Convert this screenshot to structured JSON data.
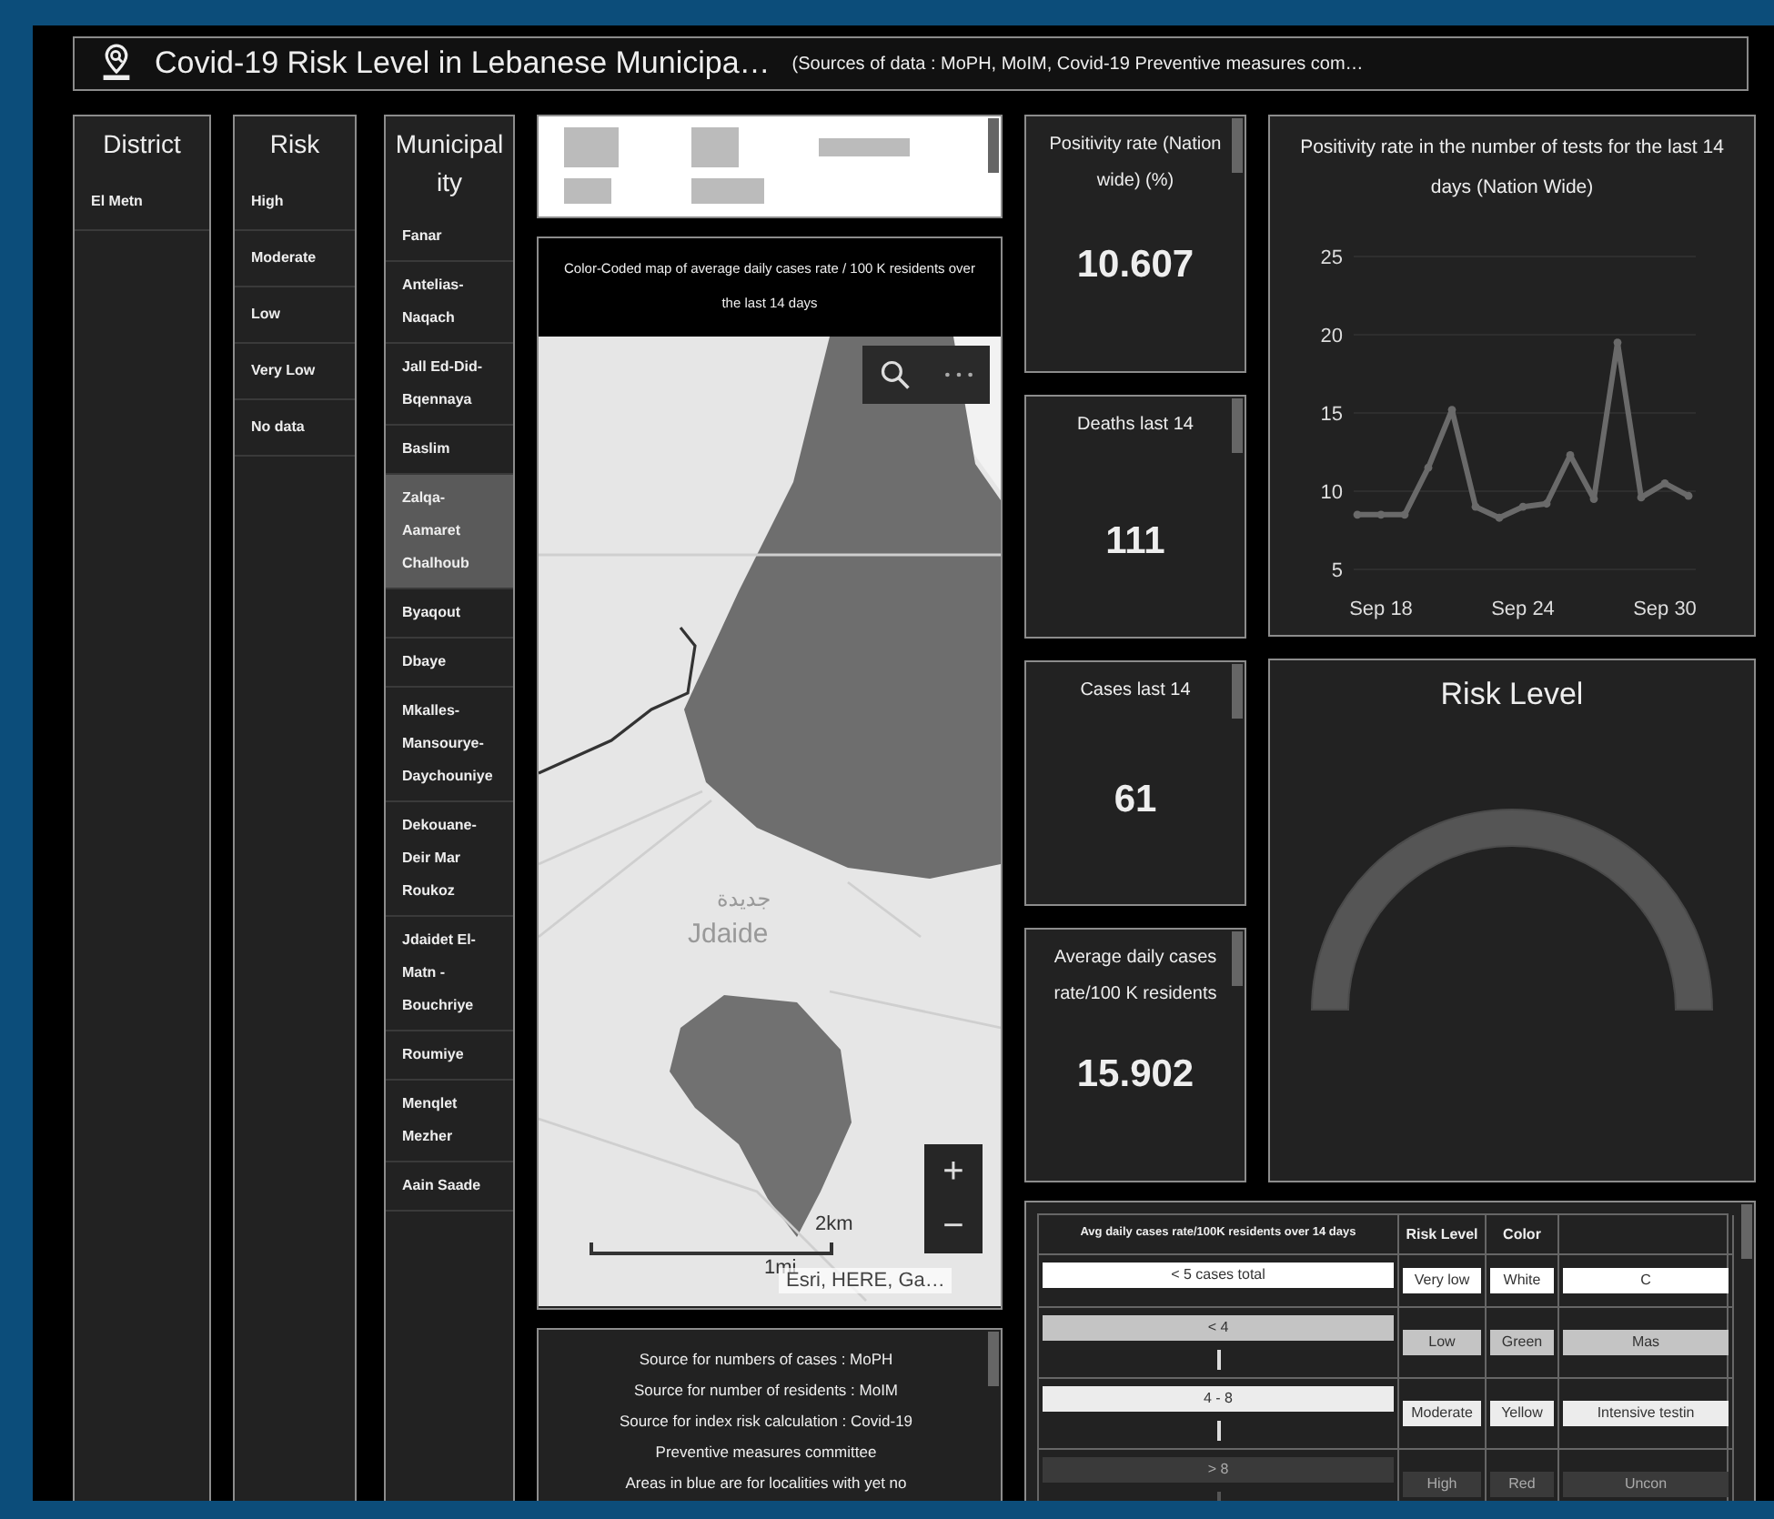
{
  "header": {
    "title": "Covid-19 Risk Level in Lebanese Municipa…",
    "subtitle": "(Sources of data : MoPH, MoIM, Covid-19 Preventive measures com…"
  },
  "district_list": {
    "title": "District",
    "items": [
      {
        "label": "El Metn",
        "selected": false
      }
    ]
  },
  "risk_list": {
    "title": "Risk",
    "items": [
      {
        "label": "High",
        "selected": false
      },
      {
        "label": "Moderate",
        "selected": false
      },
      {
        "label": "Low",
        "selected": false
      },
      {
        "label": "Very Low",
        "selected": false
      },
      {
        "label": "No data",
        "selected": false
      }
    ]
  },
  "municipality_list": {
    "title": "Municipality",
    "items": [
      {
        "label": "Fanar",
        "selected": false
      },
      {
        "label": "Antelias-Naqach",
        "selected": false
      },
      {
        "label": "Jall Ed-Did-Bqennaya",
        "selected": false
      },
      {
        "label": "Baslim",
        "selected": false
      },
      {
        "label": "Zalqa-Aamaret Chalhoub",
        "selected": true
      },
      {
        "label": "Byaqout",
        "selected": false
      },
      {
        "label": "Dbaye",
        "selected": false
      },
      {
        "label": "Mkalles-Mansourye-Daychouniye",
        "selected": false
      },
      {
        "label": "Dekouane-Deir Mar Roukoz",
        "selected": false
      },
      {
        "label": "Jdaidet El-Matn - Bouchriye",
        "selected": false
      },
      {
        "label": "Roumiye",
        "selected": false
      },
      {
        "label": "Menqlet Mezher",
        "selected": false
      },
      {
        "label": "Aain Saade",
        "selected": false
      }
    ]
  },
  "map": {
    "title": "Color-Coded map of average daily cases rate / 100 K residents over the last 14 days",
    "place_labels": [
      "جديدة",
      "Jdaide"
    ],
    "zoom_in": "+",
    "zoom_out": "−",
    "scale_km": "2km",
    "scale_mi": "1mi",
    "attribution": "Esri, HERE, Ga…"
  },
  "sources": [
    "Source for numbers of cases : MoPH",
    "Source for number of residents : MoIM",
    "Source for index risk calculation : Covid-19",
    "Preventive measures committee",
    "Areas in blue are for localities with yet no"
  ],
  "kpis": [
    {
      "title": "Positivity rate (Nation wide) (%)",
      "value": "10.607"
    },
    {
      "title": "Deaths last 14",
      "value": "111"
    },
    {
      "title": "Cases last 14",
      "value": "61"
    },
    {
      "title": "Average daily cases rate/100 K residents",
      "value": "15.902"
    }
  ],
  "trend_chart": {
    "chart_data": {
      "type": "line",
      "title": "Positivity rate in the number of tests for the last 14 days (Nation Wide)",
      "categories": [
        null,
        "Sep 18",
        null,
        null,
        null,
        null,
        null,
        "Sep 24",
        null,
        null,
        null,
        null,
        null,
        "Sep 30",
        null
      ],
      "series": [
        {
          "color": "#6a6a6a",
          "marker": true,
          "values": [
            8.5,
            8.5,
            8.5,
            11.5,
            15.2,
            9,
            8.3,
            9,
            9.2,
            12.3,
            9.5,
            19.5,
            9.6,
            10.5,
            9.7
          ]
        }
      ],
      "grid": true,
      "ylim": [
        5,
        25
      ],
      "yticks": [
        5,
        10,
        15,
        20,
        25
      ]
    }
  },
  "gauge": {
    "title": "Risk Level"
  },
  "risk_table": {
    "columns": [
      "Avg daily cases rate/100K residents over 14 days",
      "Risk Level",
      "Color"
    ],
    "rows": [
      {
        "kind": "total",
        "color": "#ffffff",
        "cells": [
          "< 5 cases total",
          "Very low",
          "White",
          "C"
        ]
      },
      {
        "kind": "range",
        "color": "#c4c4c4",
        "cells": [
          "< 4",
          "Low",
          "Green",
          "Mas"
        ]
      },
      {
        "kind": "range",
        "color": "#ececec",
        "cells": [
          "4 - 8",
          "Moderate",
          "Yellow",
          "Intensive testin"
        ]
      },
      {
        "kind": "range",
        "color": "#3a3a3a",
        "cells": [
          "> 8",
          "High",
          "Red",
          "Uncon"
        ]
      }
    ]
  }
}
